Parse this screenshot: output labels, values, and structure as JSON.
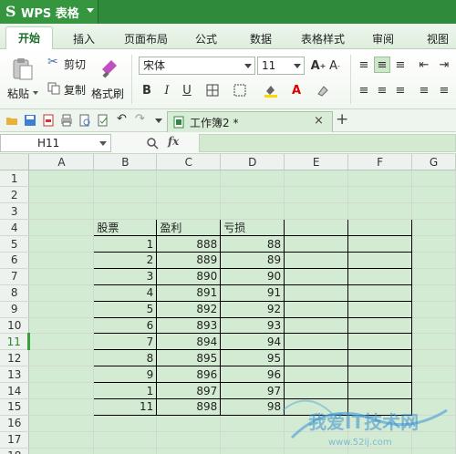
{
  "app": {
    "title": "WPS 表格",
    "logo": "S"
  },
  "ribbon_tabs": [
    "开始",
    "插入",
    "页面布局",
    "公式",
    "数据",
    "表格样式",
    "审阅",
    "视图"
  ],
  "active_tab": "开始",
  "clipboard": {
    "paste": "粘贴",
    "cut": "剪切",
    "copy": "复制",
    "format_painter": "格式刷"
  },
  "font": {
    "name": "宋体",
    "size": "11",
    "bold": "B",
    "italic": "I",
    "underline": "U"
  },
  "document_tab": {
    "name": "工作簿2 *",
    "close": "×",
    "add": "+"
  },
  "formula_bar": {
    "cell_ref": "H11",
    "fx": "fx",
    "value": ""
  },
  "columns": [
    "A",
    "B",
    "C",
    "D",
    "E",
    "F",
    "G"
  ],
  "rows": [
    "1",
    "2",
    "3",
    "4",
    "5",
    "6",
    "7",
    "8",
    "9",
    "10",
    "11",
    "12",
    "13",
    "14",
    "15",
    "16",
    "17",
    "18"
  ],
  "active_row": "11",
  "table": {
    "headers": [
      "股票",
      "盈利",
      "亏损"
    ],
    "rows": [
      [
        "1",
        "888",
        "88"
      ],
      [
        "2",
        "889",
        "89"
      ],
      [
        "3",
        "890",
        "90"
      ],
      [
        "4",
        "891",
        "91"
      ],
      [
        "5",
        "892",
        "92"
      ],
      [
        "6",
        "893",
        "93"
      ],
      [
        "7",
        "894",
        "94"
      ],
      [
        "8",
        "895",
        "95"
      ],
      [
        "9",
        "896",
        "96"
      ],
      [
        "1",
        "897",
        "97"
      ],
      [
        "11",
        "898",
        "98"
      ]
    ]
  },
  "watermark": {
    "text": "我爱IT技术网",
    "url": "www.52ij.com"
  },
  "colors": {
    "titlebar": "#2f8a3c",
    "cell_bg": "#d4ebd3",
    "accent": "#37a03a"
  }
}
